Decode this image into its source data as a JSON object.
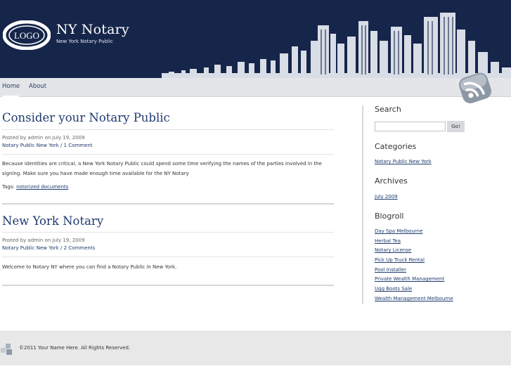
{
  "header": {
    "logo_text": "LOGO",
    "site_title": "NY Notary",
    "tagline": "New York Notary Public"
  },
  "nav": {
    "items": [
      {
        "label": "Home",
        "active": true
      },
      {
        "label": "About",
        "active": false
      }
    ]
  },
  "posts": [
    {
      "title": "Consider your Notary Public",
      "posted_by": "Posted by admin on July 19, 2009",
      "category_comments": "Notary Public New York / 1 Comment",
      "body": "Because identities are critical, a New York Notary Public could spend some time verifying the names of the parties involved in the signing. Make sure you have made enough time available for the NY Notary",
      "tags_label": "Tags:",
      "tag": "notorized documents"
    },
    {
      "title": "New York Notary",
      "posted_by": "Posted by admin on July 19, 2009",
      "category_comments": "Notary Public New York / 2 Comments",
      "body": "Welcome to Notary NY where you can find a Notary Public in New York."
    }
  ],
  "sidebar": {
    "search": {
      "heading": "Search",
      "value": "",
      "button": "Go!"
    },
    "categories": {
      "heading": "Categories",
      "items": [
        "Notary Public New York"
      ]
    },
    "archives": {
      "heading": "Archives",
      "items": [
        "July 2009"
      ]
    },
    "blogroll": {
      "heading": "Blogroll",
      "items": [
        "Day Spa Melbourne",
        "Herbal Tea",
        "Notary License",
        "Pick Up Truck Rental",
        "Pool Installer",
        "Private Wealth Management",
        "Ugg Boots Sale",
        "Wealth Management Melbourne"
      ]
    }
  },
  "footer": {
    "copyright": "©2011 Your Name Here. All Rights Reserved."
  },
  "colors": {
    "header_bg": "#16254a",
    "nav_bg": "#e3e5e8",
    "link": "#1e3a6e",
    "footer_bg": "#e8e8e8"
  },
  "icons": [
    "logo-icon",
    "skyline-graphic",
    "rss-icon",
    "footer-blocks-icon"
  ]
}
